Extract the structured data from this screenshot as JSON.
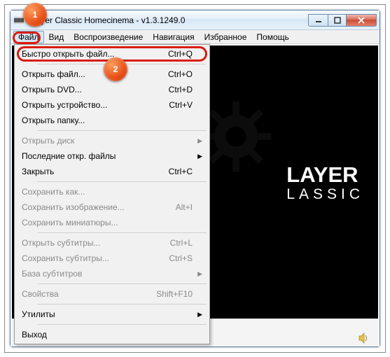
{
  "window": {
    "title": "Player Classic Homecinema - v1.3.1249.0"
  },
  "menubar": {
    "items": [
      "Файл",
      "Вид",
      "Воспроизведение",
      "Навигация",
      "Избранное",
      "Помощь"
    ],
    "active_index": 0
  },
  "logo": {
    "line1": "LAYER",
    "line2": "LASSIC"
  },
  "callouts": {
    "b1": "1",
    "b2": "2"
  },
  "dropdown": {
    "items": [
      {
        "label": "Быстро открыть файл...",
        "shortcut": "Ctrl+Q",
        "sub": false,
        "enabled": true
      },
      {
        "sep": true
      },
      {
        "label": "Открыть файл...",
        "shortcut": "Ctrl+O",
        "sub": false,
        "enabled": true
      },
      {
        "label": "Открыть DVD...",
        "shortcut": "Ctrl+D",
        "sub": false,
        "enabled": true
      },
      {
        "label": "Открыть устройство...",
        "shortcut": "Ctrl+V",
        "sub": false,
        "enabled": true
      },
      {
        "label": "Открыть папку...",
        "shortcut": "",
        "sub": false,
        "enabled": true
      },
      {
        "sep": true
      },
      {
        "label": "Открыть диск",
        "shortcut": "",
        "sub": true,
        "enabled": false
      },
      {
        "label": "Последние откр. файлы",
        "shortcut": "",
        "sub": true,
        "enabled": true
      },
      {
        "label": "Закрыть",
        "shortcut": "Ctrl+C",
        "sub": false,
        "enabled": true
      },
      {
        "sep": true
      },
      {
        "label": "Сохранить как...",
        "shortcut": "",
        "sub": false,
        "enabled": false
      },
      {
        "label": "Сохранить изображение...",
        "shortcut": "Alt+I",
        "sub": false,
        "enabled": false
      },
      {
        "label": "Сохранить миниатюры...",
        "shortcut": "",
        "sub": false,
        "enabled": false
      },
      {
        "sep": true
      },
      {
        "label": "Открыть субтитры...",
        "shortcut": "Ctrl+L",
        "sub": false,
        "enabled": false
      },
      {
        "label": "Сохранить субтитры...",
        "shortcut": "Ctrl+S",
        "sub": false,
        "enabled": false
      },
      {
        "label": "База субтитров",
        "shortcut": "",
        "sub": true,
        "enabled": false
      },
      {
        "sep": true
      },
      {
        "label": "Свойства",
        "shortcut": "Shift+F10",
        "sub": false,
        "enabled": false
      },
      {
        "sep": true
      },
      {
        "label": "Утилиты",
        "shortcut": "",
        "sub": true,
        "enabled": true
      },
      {
        "sep": true
      },
      {
        "label": "Выход",
        "shortcut": "",
        "sub": false,
        "enabled": true
      }
    ]
  }
}
